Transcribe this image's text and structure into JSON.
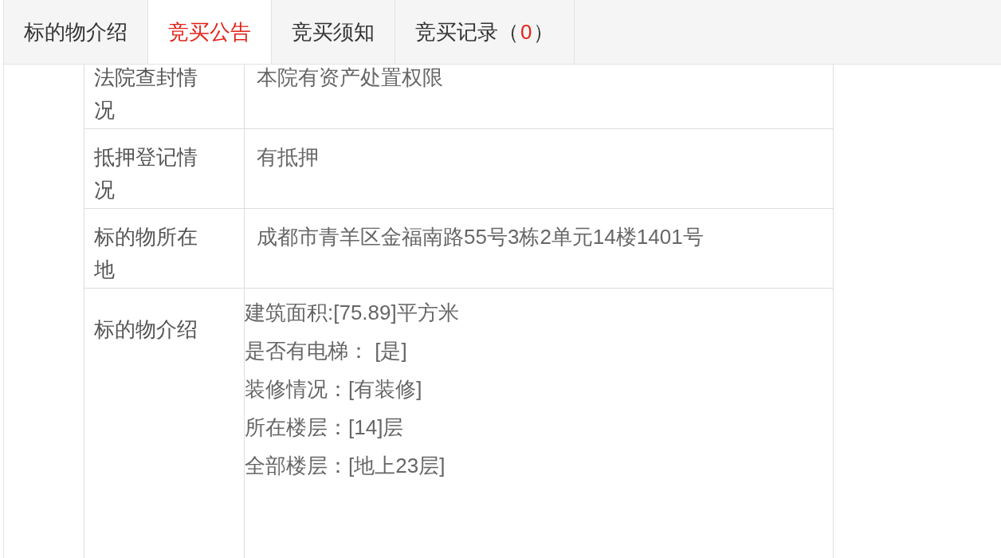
{
  "tabs": [
    {
      "label": "标的物介绍",
      "selected": false
    },
    {
      "label": "竞买公告",
      "selected": true
    },
    {
      "label": "竞买须知",
      "selected": false
    },
    {
      "label": "竞买记录（",
      "count": "0",
      "suffix": "）",
      "selected": false
    }
  ],
  "table": {
    "rows": [
      {
        "kind": "text",
        "label": "法院查封情况",
        "value": "本院有资产处置权限"
      },
      {
        "kind": "text",
        "label": "抵押登记情况",
        "value": "有抵押"
      },
      {
        "kind": "text",
        "label": "标的物所在地",
        "value": "成都市青羊区金福南路55号3栋2单元14楼1401号"
      },
      {
        "kind": "list",
        "label": "标的物介绍",
        "lines": [
          "建筑面积:[75.89]平方米",
          "是否有电梯： [是]",
          "装修情况：[有装修]",
          "所在楼层：[14]层",
          "全部楼层：[地上23层]"
        ]
      }
    ]
  }
}
